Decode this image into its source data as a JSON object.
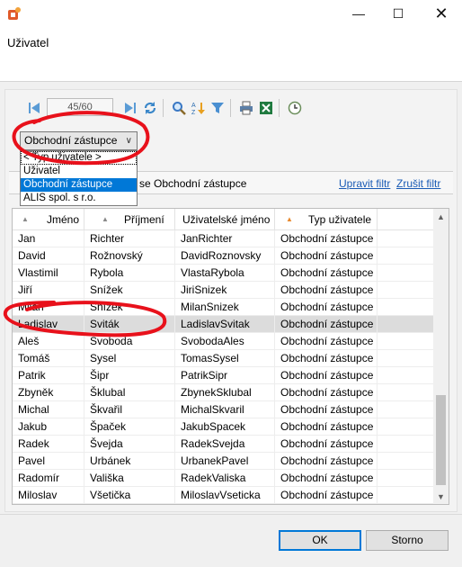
{
  "window": {
    "title": "Uživatel",
    "minimize": "—",
    "maximize": "☐",
    "close": "✕"
  },
  "toolbar": {
    "pager": "45/60"
  },
  "type_filter": {
    "selected": "Obchodní zástupce",
    "options": [
      "< Typ uživatele >",
      "Uživatel",
      "Obchodní zástupce",
      "ALIS spol. s r.o."
    ],
    "selected_index": 2
  },
  "filter": {
    "text": "se Obchodní zástupce",
    "edit_link": "Upravit filtr",
    "clear_link": "Zrušit filtr"
  },
  "grid": {
    "columns": [
      "Jméno",
      "Příjmení",
      "Uživatelské jméno",
      "Typ uživatele"
    ],
    "rows": [
      [
        "Jan",
        "Richter",
        "JanRichter",
        "Obchodní zástupce"
      ],
      [
        "David",
        "Rožnovský",
        "DavidRoznovsky",
        "Obchodní zástupce"
      ],
      [
        "Vlastimil",
        "Rybola",
        "VlastaRybola",
        "Obchodní zástupce"
      ],
      [
        "Jiří",
        "Snížek",
        "JiriSnizek",
        "Obchodní zástupce"
      ],
      [
        "Milan",
        "Snížek",
        "MilanSnizek",
        "Obchodní zástupce"
      ],
      [
        "Ladislav",
        "Sviták",
        "LadislavSvitak",
        "Obchodní zástupce"
      ],
      [
        "Aleš",
        "Svoboda",
        "SvobodaAles",
        "Obchodní zástupce"
      ],
      [
        "Tomáš",
        "Sysel",
        "TomasSysel",
        "Obchodní zástupce"
      ],
      [
        "Patrik",
        "Šipr",
        "PatrikSipr",
        "Obchodní zástupce"
      ],
      [
        "Zbyněk",
        "Šklubal",
        "ZbynekSklubal",
        "Obchodní zástupce"
      ],
      [
        "Michal",
        "Škvařil",
        "MichalSkvaril",
        "Obchodní zástupce"
      ],
      [
        "Jakub",
        "Špaček",
        "JakubSpacek",
        "Obchodní zástupce"
      ],
      [
        "Radek",
        "Švejda",
        "RadekSvejda",
        "Obchodní zástupce"
      ],
      [
        "Pavel",
        "Urbánek",
        "UrbanekPavel",
        "Obchodní zástupce"
      ],
      [
        "Radomír",
        "Vališka",
        "RadekValiska",
        "Obchodní zástupce"
      ],
      [
        "Miloslav",
        "Všetička",
        "MiloslavVseticka",
        "Obchodní zástupce"
      ]
    ],
    "highlighted_row": 5
  },
  "buttons": {
    "ok": "OK",
    "cancel": "Storno"
  },
  "colors": {
    "accent": "#0078d7",
    "annotation": "#e8111b",
    "link": "#1a5bb5"
  }
}
